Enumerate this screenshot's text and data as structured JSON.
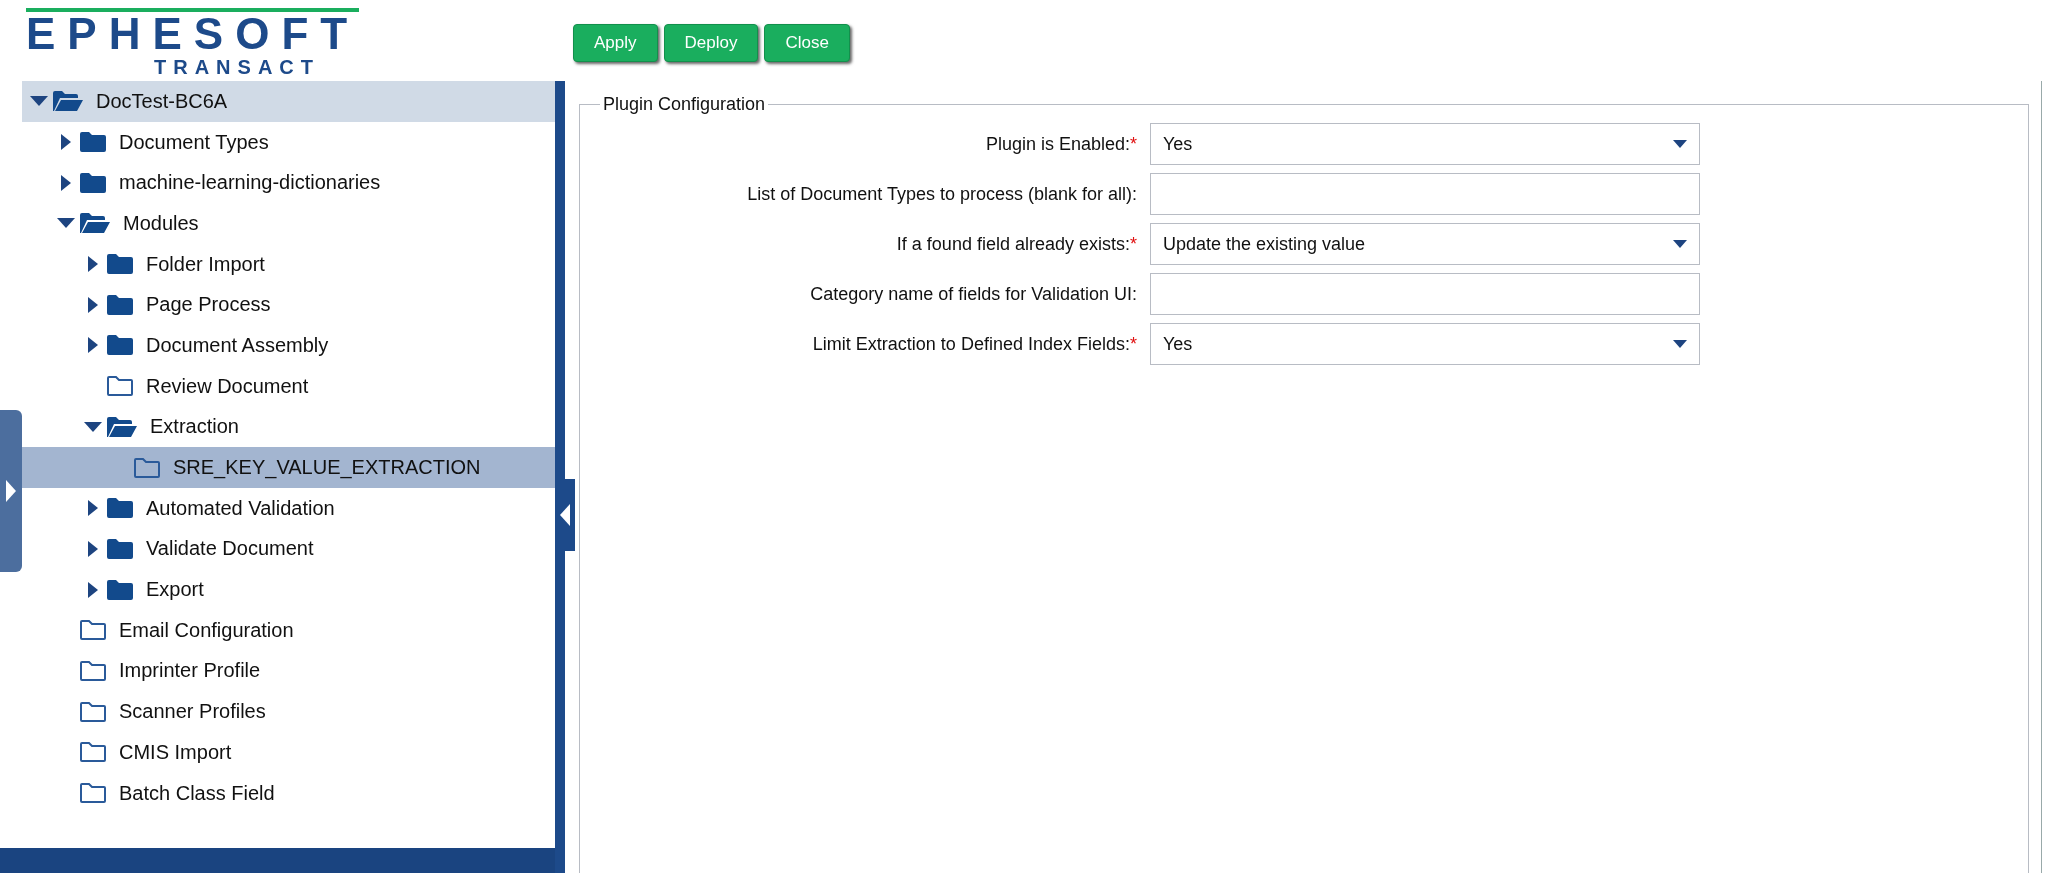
{
  "logo": {
    "wordmark": "EPHESOFT",
    "product": "TRANSACT"
  },
  "toolbar": {
    "buttons": [
      "Apply",
      "Deploy",
      "Close"
    ]
  },
  "tree": {
    "root": {
      "label": "DocTest-BC6A",
      "expanded": true,
      "children": [
        {
          "label": "Document Types",
          "kind": "branch",
          "expanded": false,
          "selected": false
        },
        {
          "label": "machine-learning-dictionaries",
          "kind": "branch",
          "expanded": false,
          "selected": false
        },
        {
          "label": "Modules",
          "kind": "branch",
          "expanded": true,
          "selected": false,
          "children": [
            {
              "label": "Folder Import",
              "kind": "branch",
              "expanded": false,
              "selected": false
            },
            {
              "label": "Page Process",
              "kind": "branch",
              "expanded": false,
              "selected": false
            },
            {
              "label": "Document Assembly",
              "kind": "branch",
              "expanded": false,
              "selected": false
            },
            {
              "label": "Review Document",
              "kind": "leaf",
              "selected": false
            },
            {
              "label": "Extraction",
              "kind": "branch",
              "expanded": true,
              "selected": false,
              "children": [
                {
                  "label": "SRE_KEY_VALUE_EXTRACTION",
                  "kind": "leaf",
                  "selected": true
                }
              ]
            },
            {
              "label": "Automated Validation",
              "kind": "branch",
              "expanded": false,
              "selected": false
            },
            {
              "label": "Validate Document",
              "kind": "branch",
              "expanded": false,
              "selected": false
            },
            {
              "label": "Export",
              "kind": "branch",
              "expanded": false,
              "selected": false
            }
          ]
        },
        {
          "label": "Email Configuration",
          "kind": "leaf",
          "selected": false
        },
        {
          "label": "Imprinter Profile",
          "kind": "leaf",
          "selected": false
        },
        {
          "label": "Scanner Profiles",
          "kind": "leaf",
          "selected": false
        },
        {
          "label": "CMIS Import",
          "kind": "leaf",
          "selected": false
        },
        {
          "label": "Batch Class Field",
          "kind": "leaf",
          "selected": false
        }
      ]
    }
  },
  "plugin_configuration": {
    "title": "Plugin Configuration",
    "fields": [
      {
        "label": "Plugin is Enabled:",
        "marker": "*",
        "kind": "select",
        "value": "Yes"
      },
      {
        "label": "List of Document Types to process (blank for all):",
        "kind": "text"
      },
      {
        "label": "If a found field already exists:",
        "marker": "*",
        "kind": "select",
        "value": "Update the existing value"
      },
      {
        "label": "Category name of fields for Validation UI:",
        "kind": "text"
      },
      {
        "label": "Limit Extraction to Defined Index Fields:",
        "marker": "*",
        "kind": "select",
        "value": "Yes"
      }
    ]
  }
}
